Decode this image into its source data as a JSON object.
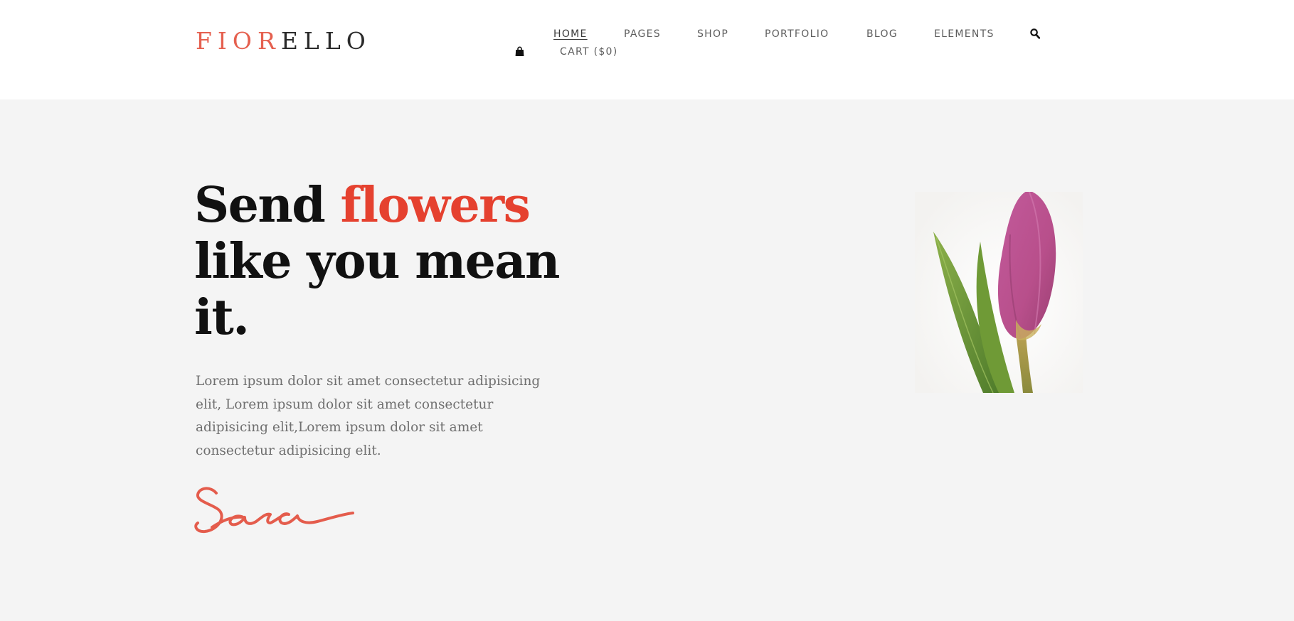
{
  "brand": {
    "logo_accent": "FIOR",
    "logo_rest": "ELLO",
    "accent_color": "#e5604f",
    "headline_accent_color": "#e5412f",
    "signature_color": "#e45c4c"
  },
  "nav": {
    "items": [
      {
        "label": "HOME",
        "active": true
      },
      {
        "label": "PAGES",
        "active": false
      },
      {
        "label": "SHOP",
        "active": false
      },
      {
        "label": "PORTFOLIO",
        "active": false
      },
      {
        "label": "BLOG",
        "active": false
      },
      {
        "label": "ELEMENTS",
        "active": false
      }
    ],
    "search_icon": "search-icon",
    "cart_icon": "shopping-bag-icon",
    "cart_label": "CART ($0)"
  },
  "hero": {
    "headline_part1": "Send ",
    "headline_accent": "flowers",
    "headline_part2": "like you mean it.",
    "body": "Lorem ipsum dolor sit amet consectetur adipisicing elit, Lorem ipsum dolor sit amet consectetur adipisicing elit,Lorem ipsum dolor sit amet consectetur adipisicing elit.",
    "signature": "Sara",
    "image": "pink-tulip"
  }
}
